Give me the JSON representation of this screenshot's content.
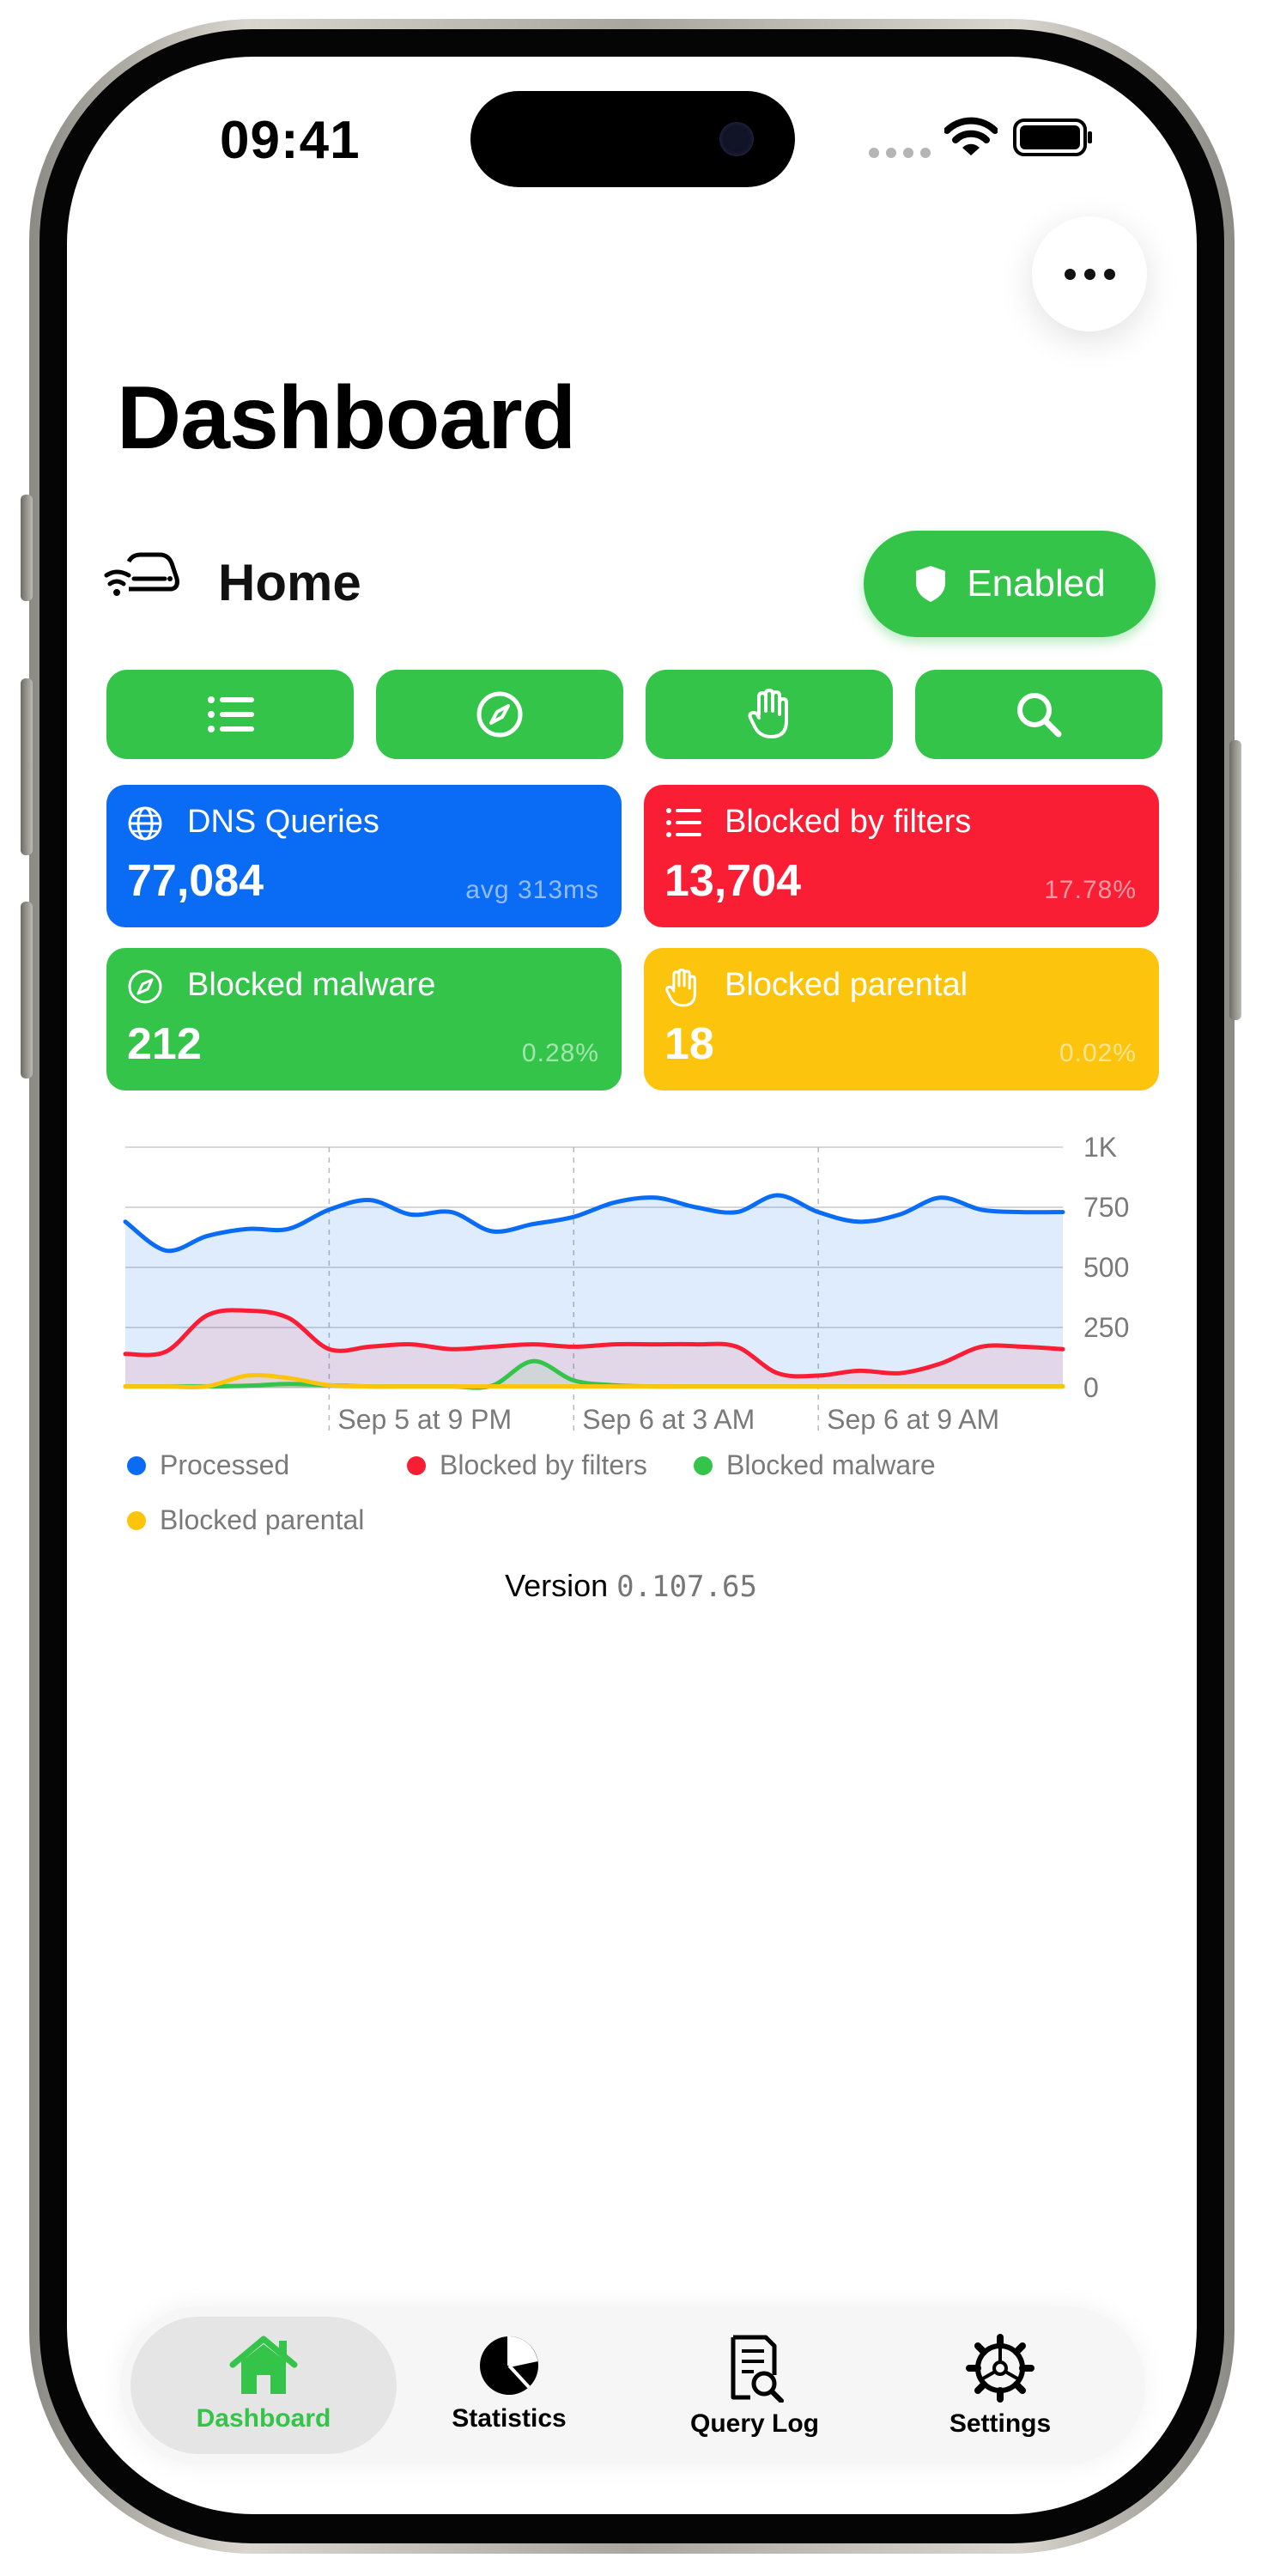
{
  "status_bar": {
    "time": "09:41"
  },
  "header": {
    "title": "Dashboard",
    "menu_icon": "ellipsis-icon"
  },
  "device": {
    "name": "Home",
    "icon": "router-icon"
  },
  "protection": {
    "label": "Enabled",
    "icon": "shield-icon",
    "color": "#34c44a"
  },
  "actions": [
    {
      "icon": "list-icon"
    },
    {
      "icon": "compass-icon"
    },
    {
      "icon": "hand-icon"
    },
    {
      "icon": "search-icon"
    }
  ],
  "cards": {
    "dns_queries": {
      "title": "DNS Queries",
      "value": "77,084",
      "sub": "avg 313ms",
      "color": "#0a6cf5",
      "icon": "globe-icon"
    },
    "blocked_filters": {
      "title": "Blocked by filters",
      "value": "13,704",
      "sub": "17.78%",
      "color": "#fa1e35",
      "icon": "list-icon"
    },
    "blocked_malware": {
      "title": "Blocked malware",
      "value": "212",
      "sub": "0.28%",
      "color": "#34c44a",
      "icon": "compass-icon"
    },
    "blocked_parental": {
      "title": "Blocked parental",
      "value": "18",
      "sub": "0.02%",
      "color": "#fdc40d",
      "icon": "hand-icon"
    }
  },
  "chart_data": {
    "type": "area",
    "x": [
      0,
      1,
      2,
      3,
      4,
      5,
      6,
      7,
      8,
      9,
      10,
      11,
      12,
      13,
      14,
      15,
      16,
      17,
      18,
      19,
      20,
      21,
      22,
      23
    ],
    "x_tick_labels": [
      {
        "at": 5,
        "label": "Sep 5 at 9 PM"
      },
      {
        "at": 11,
        "label": "Sep 6 at 3 AM"
      },
      {
        "at": 17,
        "label": "Sep 6 at 9 AM"
      }
    ],
    "y_ticks": [
      "0",
      "250",
      "500",
      "750",
      "1K"
    ],
    "ylim": [
      0,
      1000
    ],
    "series": [
      {
        "name": "Processed",
        "color": "#0a6cf5",
        "values": [
          690,
          570,
          630,
          660,
          660,
          740,
          780,
          720,
          730,
          650,
          680,
          710,
          770,
          790,
          750,
          730,
          800,
          730,
          690,
          720,
          790,
          740,
          730,
          730
        ]
      },
      {
        "name": "Blocked by filters",
        "color": "#fa1e35",
        "values": [
          140,
          150,
          300,
          320,
          290,
          160,
          170,
          180,
          160,
          170,
          180,
          170,
          180,
          180,
          180,
          170,
          60,
          50,
          70,
          60,
          100,
          170,
          170,
          160
        ]
      },
      {
        "name": "Blocked malware",
        "color": "#34c44a",
        "values": [
          5,
          5,
          5,
          8,
          15,
          10,
          5,
          5,
          5,
          8,
          110,
          30,
          10,
          5,
          5,
          5,
          5,
          5,
          5,
          5,
          5,
          5,
          5,
          5
        ]
      },
      {
        "name": "Blocked parental",
        "color": "#fdc40d",
        "values": [
          5,
          5,
          5,
          50,
          40,
          10,
          5,
          5,
          5,
          5,
          5,
          5,
          5,
          5,
          5,
          5,
          5,
          5,
          5,
          5,
          5,
          5,
          5,
          5
        ]
      }
    ],
    "grid": true,
    "legend": "bottom"
  },
  "footer": {
    "version_label": "Version",
    "version_number": "0.107.65"
  },
  "tabs": [
    {
      "label": "Dashboard",
      "icon": "house-icon",
      "active": true
    },
    {
      "label": "Statistics",
      "icon": "pie-chart-icon",
      "active": false
    },
    {
      "label": "Query Log",
      "icon": "query-log-icon",
      "active": false
    },
    {
      "label": "Settings",
      "icon": "gear-icon",
      "active": false
    }
  ]
}
